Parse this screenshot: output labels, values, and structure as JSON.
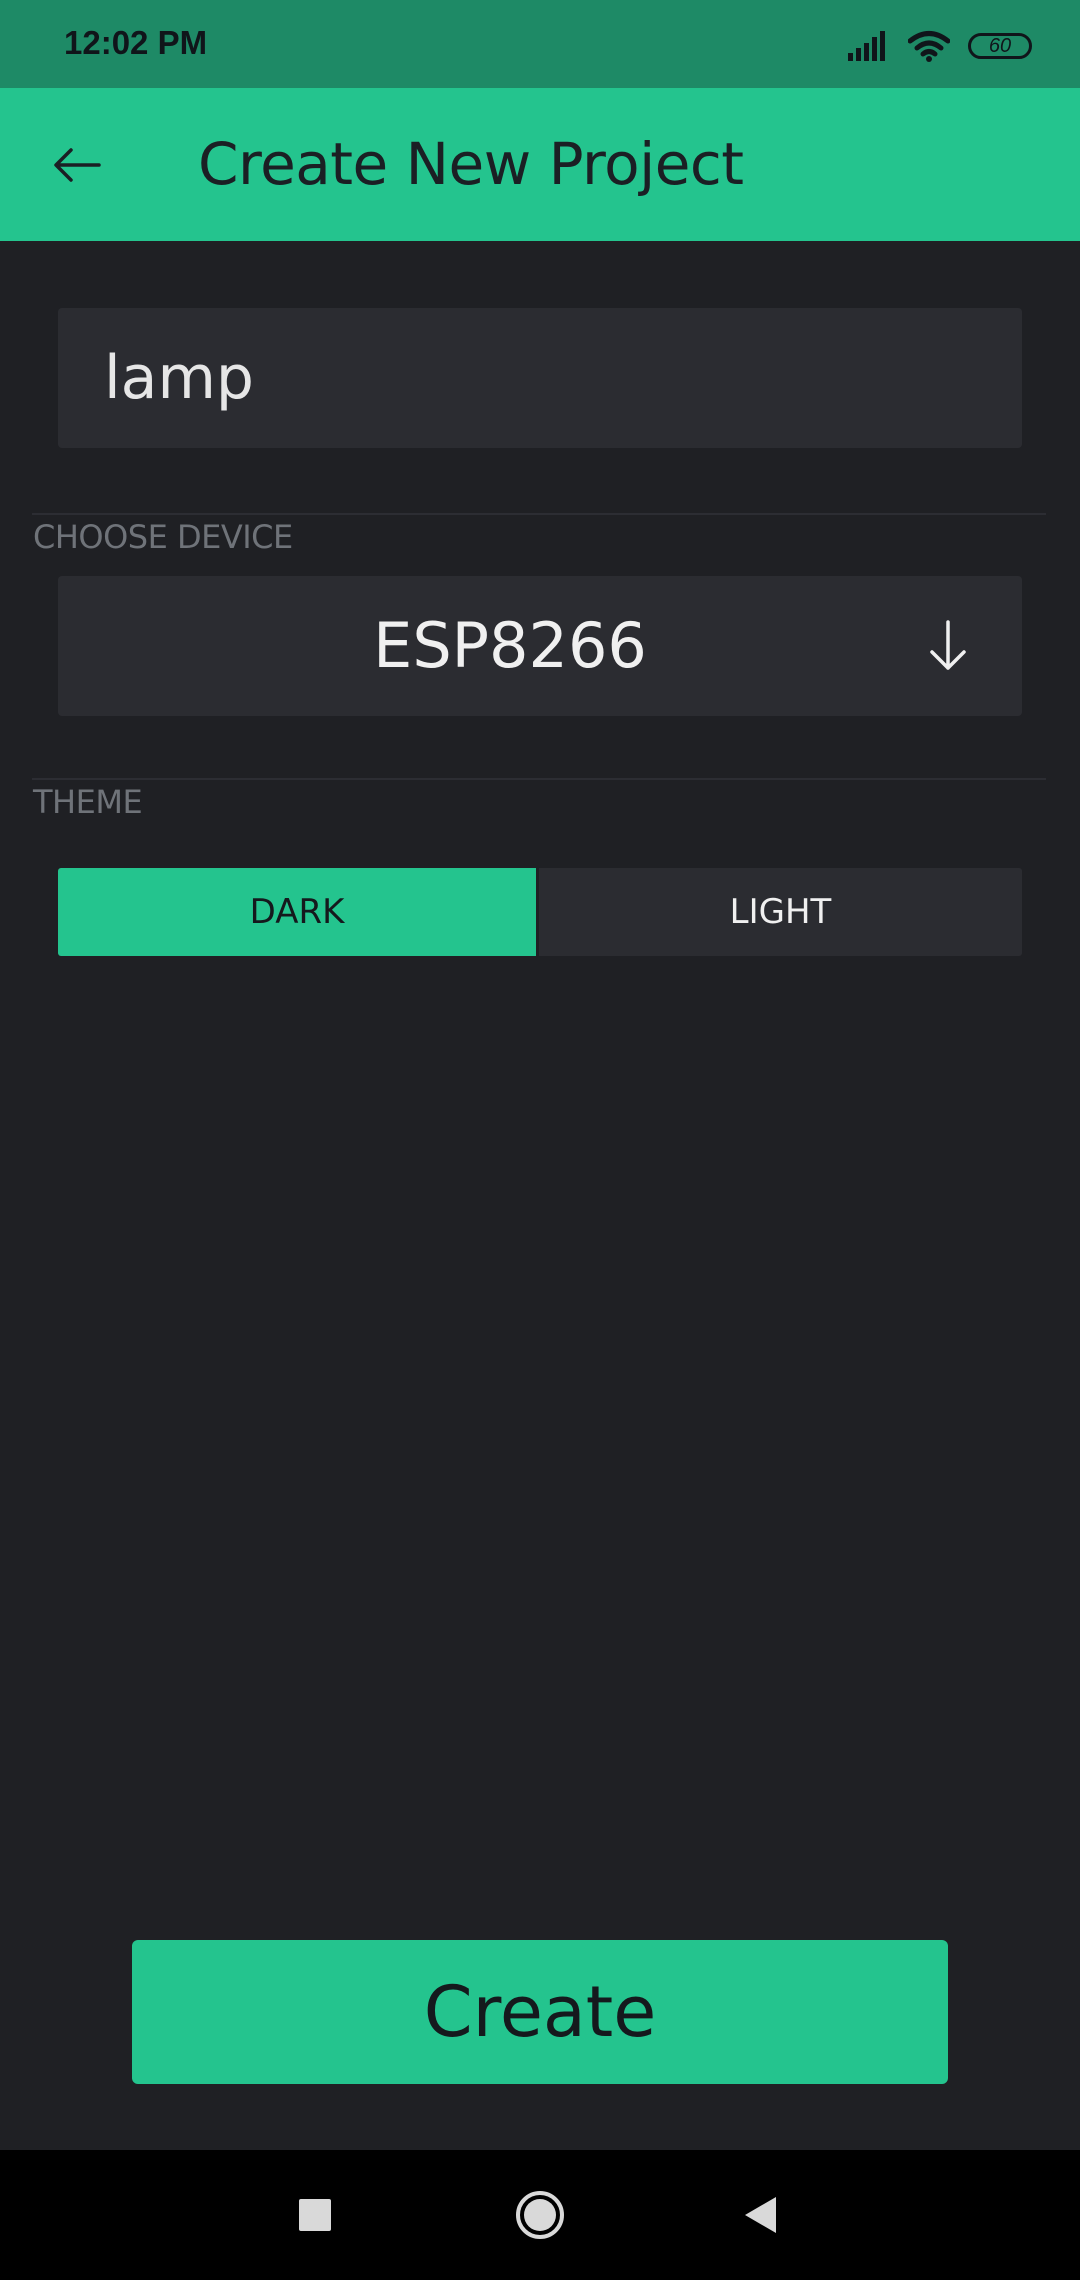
{
  "status_bar": {
    "time": "12:02 PM",
    "battery": "60",
    "icons": [
      "signal-icon",
      "wifi-icon",
      "battery-icon"
    ]
  },
  "app_bar": {
    "title": "Create New Project",
    "back_icon": "arrow-left-icon"
  },
  "form": {
    "project_name": "lamp",
    "choose_device_label": "CHOOSE DEVICE",
    "device_value": "ESP8266",
    "device_icon": "arrow-down-icon",
    "theme_label": "THEME",
    "theme_options": [
      "DARK",
      "LIGHT"
    ],
    "theme_selected": "DARK"
  },
  "create_button": "Create",
  "nav_bar": {
    "icons": [
      "recents-square-icon",
      "home-circle-icon",
      "back-triangle-icon"
    ]
  },
  "colors": {
    "accent": "#24c48e",
    "status_bar": "#1e8a66",
    "background": "#1f2024",
    "surface": "#2b2c31"
  }
}
